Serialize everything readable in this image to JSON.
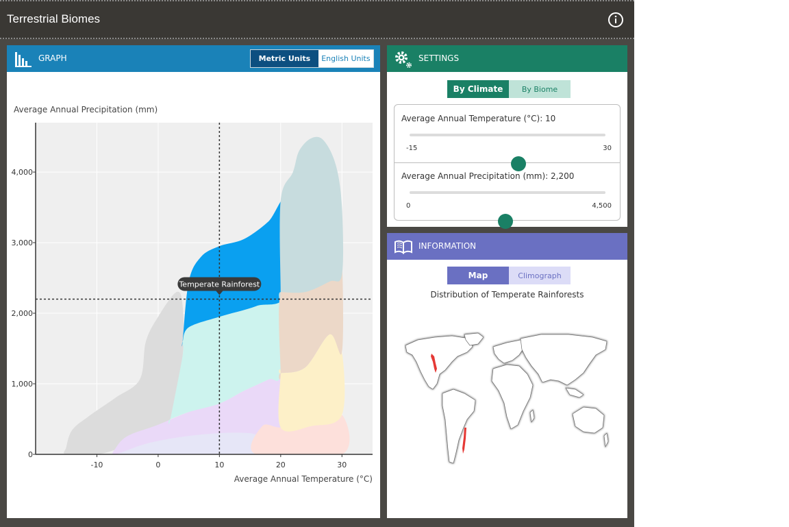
{
  "app": {
    "title": "Terrestrial Biomes",
    "info_icon": "info-icon"
  },
  "graph_panel": {
    "header_label": "GRAPH",
    "icon": "bar-chart-icon",
    "metric_label": "Metric Units",
    "english_label": "English Units"
  },
  "settings_panel": {
    "header_label": "SETTINGS",
    "icon": "gear-icon",
    "by_climate_label": "By Climate",
    "by_biome_label": "By Biome",
    "temperature_slider": {
      "label": "Average Annual Temperature (°C): 10",
      "min_label": "-15",
      "max_label": "30",
      "min": -15,
      "max": 30,
      "value": 10
    },
    "precipitation_slider": {
      "label": "Average Annual Precipitation (mm): 2,200",
      "min_label": "0",
      "max_label": "4,500",
      "min": 0,
      "max": 4500,
      "value": 2200
    }
  },
  "info_panel": {
    "header_label": "INFORMATION",
    "icon": "book-icon",
    "map_label": "Map",
    "climograph_label": "Climograph",
    "distribution_title": "Distribution of Temperate Rainforests"
  },
  "colors": {
    "graph_header": "#1a82b8",
    "settings_header": "#1a8065",
    "info_header": "#6a70c2",
    "selected_biome": "#0aa0f0"
  },
  "chart_data": {
    "type": "area",
    "xlabel": "Average Annual Temperature (°C)",
    "ylabel": "Average Annual Precipitation (mm)",
    "xlim": [
      -20,
      35
    ],
    "ylim": [
      0,
      4700
    ],
    "x_ticks": [
      -10,
      0,
      10,
      20,
      30
    ],
    "x_tick_labels": [
      "-10",
      "0",
      "10",
      "20",
      "30"
    ],
    "y_ticks": [
      0,
      1000,
      2000,
      3000,
      4000
    ],
    "y_tick_labels": [
      "0",
      "1,000",
      "2,000",
      "3,000",
      "4,000"
    ],
    "grid": true,
    "crosshair": {
      "x": 10,
      "y": 2200
    },
    "tooltip": "Temperate Rainforest",
    "regions": [
      {
        "color": "#dcdcdc",
        "points": [
          [
            -15,
            100
          ],
          [
            -14,
            350
          ],
          [
            -11,
            560
          ],
          [
            -7,
            800
          ],
          [
            -3,
            1060
          ],
          [
            -2,
            1600
          ],
          [
            0,
            1950
          ],
          [
            3,
            2300
          ],
          [
            4,
            2100
          ],
          [
            4,
            1400
          ],
          [
            2,
            500
          ],
          [
            -1,
            300
          ],
          [
            -6,
            100
          ],
          [
            -10,
            0
          ],
          [
            -15,
            0
          ]
        ]
      },
      {
        "color": "#e6e6f7",
        "points": [
          [
            -6,
            0
          ],
          [
            -2,
            150
          ],
          [
            4,
            260
          ],
          [
            10,
            320
          ],
          [
            17,
            400
          ],
          [
            16,
            0
          ]
        ]
      },
      {
        "color": "#ead9f8",
        "points": [
          [
            -7,
            80
          ],
          [
            -5,
            260
          ],
          [
            0,
            420
          ],
          [
            5,
            600
          ],
          [
            10,
            720
          ],
          [
            14,
            900
          ],
          [
            18,
            1060
          ],
          [
            20,
            1150
          ],
          [
            20,
            250
          ],
          [
            15,
            300
          ],
          [
            10,
            300
          ],
          [
            4,
            250
          ],
          [
            -2,
            150
          ],
          [
            -7,
            0
          ]
        ]
      },
      {
        "color": "#cdf3ee",
        "points": [
          [
            2,
            500
          ],
          [
            4,
            1400
          ],
          [
            4,
            1600
          ],
          [
            5,
            1800
          ],
          [
            10,
            1950
          ],
          [
            16,
            2100
          ],
          [
            20,
            2300
          ],
          [
            20,
            1150
          ],
          [
            18,
            1060
          ],
          [
            14,
            900
          ],
          [
            10,
            720
          ],
          [
            5,
            600
          ],
          [
            2,
            500
          ]
        ]
      },
      {
        "color": "#0aa0f0",
        "selected": true,
        "points": [
          [
            4,
            1600
          ],
          [
            5,
            2450
          ],
          [
            7,
            2800
          ],
          [
            10,
            2950
          ],
          [
            14,
            3050
          ],
          [
            18,
            3300
          ],
          [
            21,
            3600
          ],
          [
            21,
            2300
          ],
          [
            16,
            2100
          ],
          [
            10,
            1950
          ],
          [
            5,
            1800
          ],
          [
            4,
            1600
          ]
        ]
      },
      {
        "color": "#fde0db",
        "points": [
          [
            16,
            0
          ],
          [
            17,
            400
          ],
          [
            20,
            380
          ],
          [
            25,
            400
          ],
          [
            30,
            560
          ],
          [
            30,
            0
          ]
        ]
      },
      {
        "color": "#fdf0c8",
        "points": [
          [
            20,
            1150
          ],
          [
            20,
            380
          ],
          [
            25,
            400
          ],
          [
            30,
            560
          ],
          [
            30,
            1450
          ],
          [
            28,
            1700
          ],
          [
            24,
            1230
          ],
          [
            20,
            1150
          ]
        ]
      },
      {
        "color": "#ecd8c8",
        "points": [
          [
            20,
            1150
          ],
          [
            20,
            2300
          ],
          [
            24,
            2400
          ],
          [
            29,
            2550
          ],
          [
            30,
            2700
          ],
          [
            30,
            1450
          ],
          [
            28,
            1700
          ],
          [
            24,
            1230
          ],
          [
            20,
            1150
          ]
        ]
      },
      {
        "color": "#c7dcde",
        "points": [
          [
            20,
            2300
          ],
          [
            20,
            3600
          ],
          [
            22,
            4000
          ],
          [
            23,
            4300
          ],
          [
            25,
            4480
          ],
          [
            27,
            4450
          ],
          [
            29,
            4100
          ],
          [
            30,
            3500
          ],
          [
            30,
            2550
          ],
          [
            28,
            2450
          ],
          [
            24,
            2300
          ],
          [
            20,
            2300
          ]
        ]
      }
    ]
  }
}
